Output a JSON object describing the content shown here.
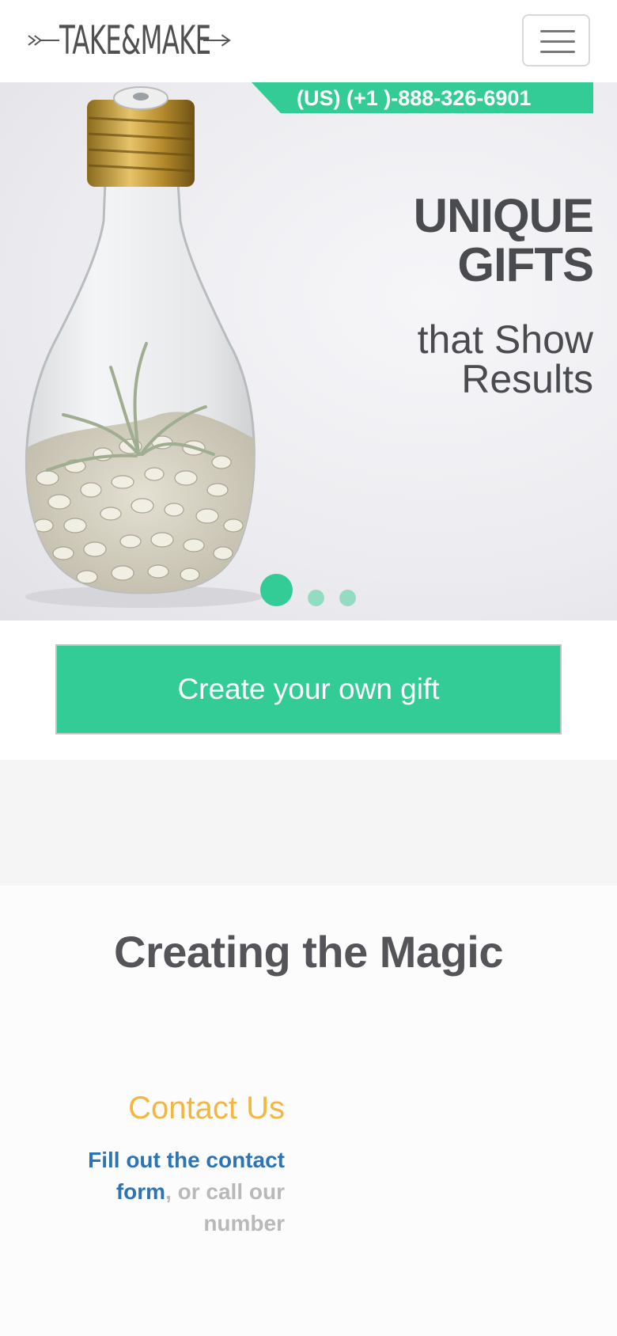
{
  "header": {
    "logo_text": "TAKE&MAKE",
    "menu_icon": "hamburger-icon"
  },
  "hero": {
    "phone": "(US) (+1 )-888-326-6901",
    "title_line1": "UNIQUE",
    "title_line2": "GIFTS",
    "subtitle_line1": "that Show",
    "subtitle_line2": "Results",
    "image": "light-bulb-terrarium-image",
    "slider": {
      "active_index": 1,
      "count": 3
    }
  },
  "cta": {
    "label": "Create your own gift"
  },
  "section": {
    "title": "Creating the Magic"
  },
  "contact": {
    "title": "Contact Us",
    "link_text": "Fill out the contact form",
    "rest_text": ", or call our number"
  },
  "colors": {
    "accent_green": "#33cc96",
    "heading_gray": "#4a4b4f",
    "contact_orange": "#f3b640",
    "link_blue": "#2e74b5"
  }
}
